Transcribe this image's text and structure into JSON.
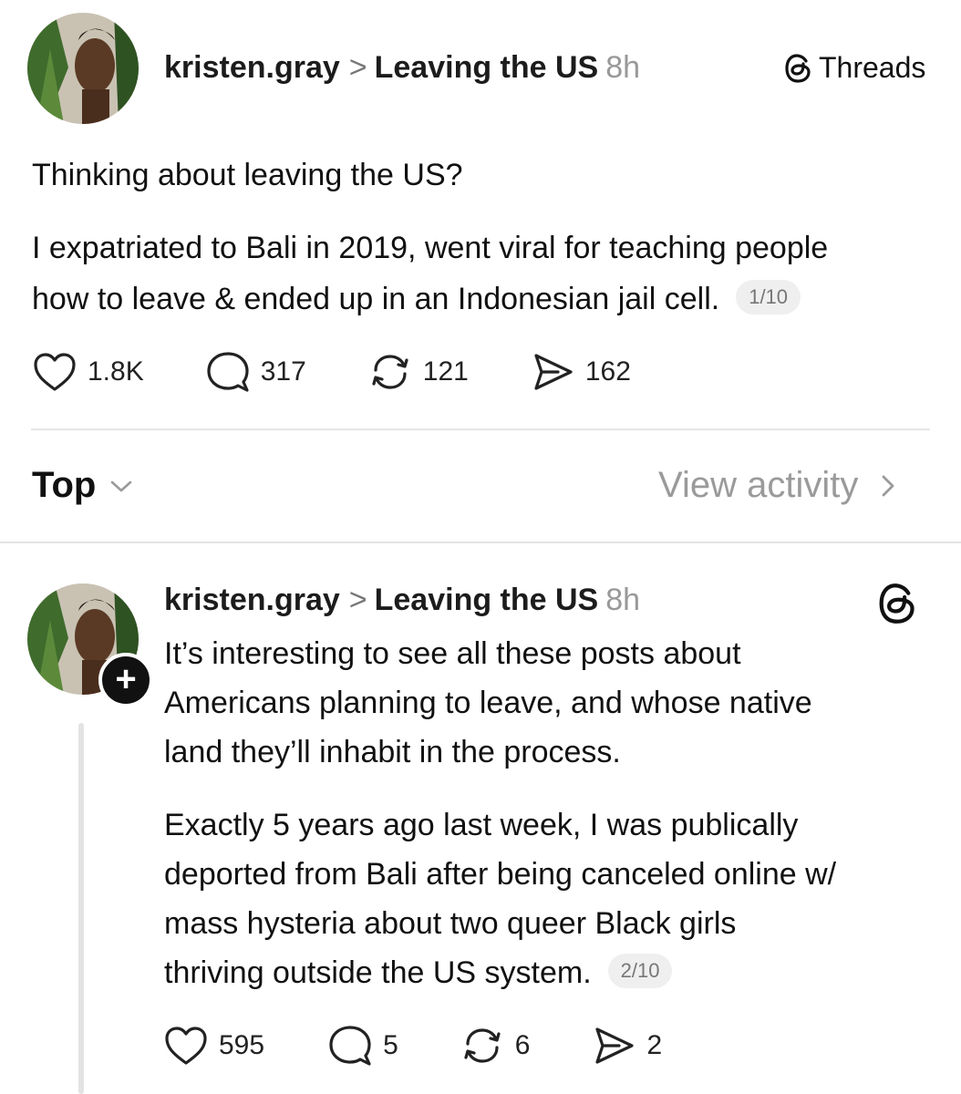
{
  "post": {
    "username": "kristen.gray",
    "separator": ">",
    "topic": "Leaving the US",
    "time": "8h",
    "threads_label": "Threads",
    "line1": "Thinking about leaving the US?",
    "line2": "I expatriated to Bali in 2019, went viral for teaching people",
    "line3": "how to leave & ended up in an Indonesian jail cell.",
    "page": "1/10",
    "likes": "1.8K",
    "replies": "317",
    "reposts": "121",
    "shares": "162"
  },
  "sort": {
    "label": "Top",
    "view_activity": "View activity"
  },
  "reply": {
    "username": "kristen.gray",
    "separator": ">",
    "topic": "Leaving the US",
    "time": "8h",
    "p1": [
      "It’s interesting to see all these posts about",
      "Americans planning to leave, and whose native",
      "land they’ll inhabit in the process."
    ],
    "p2": [
      "Exactly 5 years ago last week, I was publically",
      "deported from Bali after being canceled online w/",
      "mass hysteria about two queer Black girls",
      "thriving outside the US system."
    ],
    "page": "2/10",
    "likes": "595",
    "replies": "5",
    "reposts": "6",
    "shares": "2"
  },
  "colors": {
    "text": "#111111",
    "muted": "#999999",
    "divider": "#e4e4e4",
    "pill_bg": "#efefef"
  },
  "icons": [
    "heart-icon",
    "comment-icon",
    "repost-icon",
    "share-icon",
    "threads-logo-icon",
    "chevron-down-icon",
    "chevron-right-icon",
    "plus-icon"
  ]
}
